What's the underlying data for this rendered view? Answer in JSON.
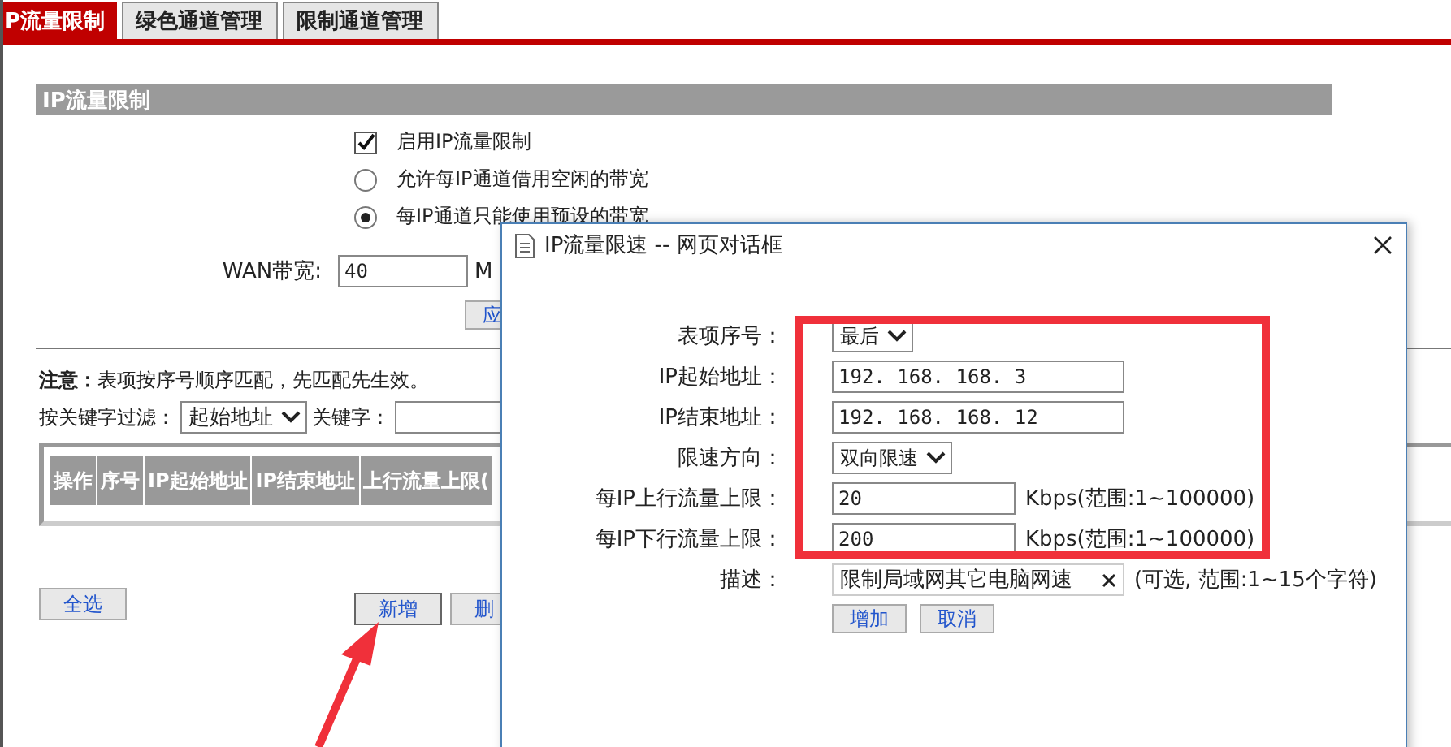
{
  "tabs": [
    {
      "label": "P流量限制",
      "selected": true
    },
    {
      "label": "绿色通道管理",
      "selected": false
    },
    {
      "label": "限制通道管理",
      "selected": false
    }
  ],
  "section_title": "IP流量限制",
  "options": [
    {
      "kind": "checkbox",
      "label": "启用IP流量限制",
      "checked": true
    },
    {
      "kind": "radio",
      "label": "允许每IP通道借用空闲的带宽",
      "selected": false
    },
    {
      "kind": "radio",
      "label": "每IP通道只能使用预设的带宽",
      "selected": true
    }
  ],
  "wan": {
    "label": "WAN带宽:",
    "value": "40",
    "unit": "M"
  },
  "apply_button": "应",
  "note": {
    "bold": "注意：",
    "text": "表项按序号顺序匹配，先匹配先生效。"
  },
  "filter": {
    "label": "按关键字过滤：",
    "select": "起始地址",
    "keyword_label": "关键字："
  },
  "table": {
    "columns": [
      "操作",
      "序号",
      "IP起始地址",
      "IP结束地址",
      "上行流量上限("
    ]
  },
  "bottom_buttons": {
    "select_all": "全选",
    "add": "新增",
    "delete": "删"
  },
  "dialog": {
    "title": "IP流量限速 -- 网页对话框",
    "fields": [
      {
        "kind": "select",
        "label": "表项序号：",
        "value": "最后"
      },
      {
        "kind": "input",
        "label": "IP起始地址：",
        "value": "192. 168. 168. 3"
      },
      {
        "kind": "input",
        "label": "IP结束地址：",
        "value": "192. 168. 168. 12"
      },
      {
        "kind": "select",
        "label": "限速方向：",
        "value": "双向限速"
      },
      {
        "kind": "short",
        "label": "每IP上行流量上限：",
        "value": "20",
        "hint": "Kbps(范围:1~100000)"
      },
      {
        "kind": "short",
        "label": "每IP下行流量上限：",
        "value": "200",
        "hint": "Kbps(范围:1~100000)"
      },
      {
        "kind": "clearable",
        "label": "描述：",
        "value": "限制局域网其它电脑网速",
        "hint": "(可选, 范围:1~15个字符)"
      }
    ],
    "buttons": [
      "增加",
      "取消"
    ]
  }
}
